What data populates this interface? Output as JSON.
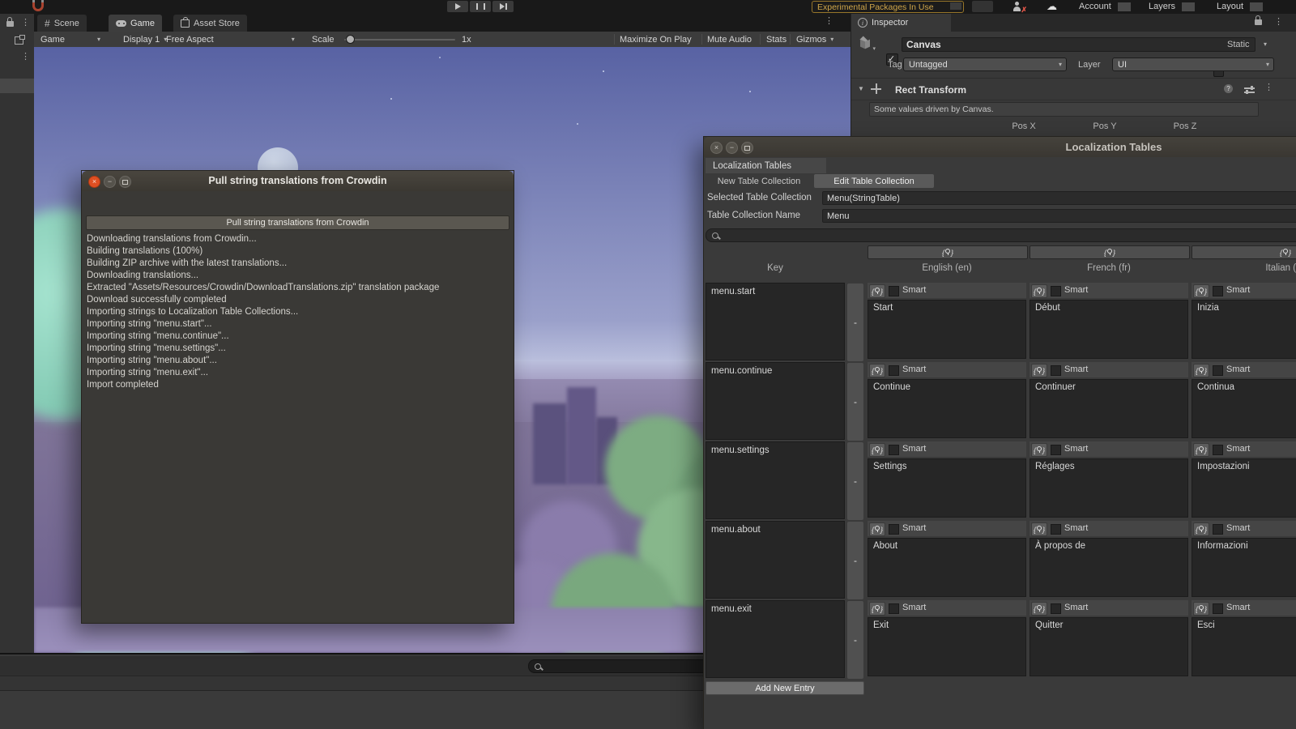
{
  "colors": {
    "warning_accent": "#cfa64a",
    "close_button": "#df4f22",
    "panel_bg": "#383838"
  },
  "top_toolbar": {
    "experimental_badge": "Experimental Packages In Use",
    "account": "Account",
    "layers": "Layers",
    "layout": "Layout"
  },
  "view_tabs": {
    "scene": "Scene",
    "game": "Game",
    "asset_store": "Asset Store"
  },
  "game_toolbar": {
    "target": "Game",
    "display": "Display 1",
    "aspect": "Free Aspect",
    "scale_label": "Scale",
    "scale_value": "1x",
    "maximize": "Maximize On Play",
    "mute": "Mute Audio",
    "stats": "Stats",
    "gizmos": "Gizmos"
  },
  "inspector": {
    "tab": "Inspector",
    "object_name": "Canvas",
    "static_label": "Static",
    "tag_label": "Tag",
    "tag_value": "Untagged",
    "layer_label": "Layer",
    "layer_value": "UI",
    "component": "Rect Transform",
    "helpbox": "Some values driven by Canvas.",
    "pos_x": "Pos X",
    "pos_y": "Pos Y",
    "pos_z": "Pos Z"
  },
  "dialog": {
    "title": "Pull string translations from Crowdin",
    "button": "Pull string translations from Crowdin",
    "log": [
      "Downloading translations from Crowdin...",
      "Building translations (100%)",
      "Building ZIP archive with the latest translations...",
      "Downloading translations...",
      "Extracted \"Assets/Resources/Crowdin/DownloadTranslations.zip\" translation package",
      "Download successfully completed",
      "Importing strings to Localization Table Collections...",
      "Importing string \"menu.start\"...",
      "Importing string \"menu.continue\"...",
      "Importing string \"menu.settings\"...",
      "Importing string \"menu.about\"...",
      "Importing string \"menu.exit\"...",
      "Import completed"
    ]
  },
  "loc": {
    "title": "Localization Tables",
    "tab": "Localization Tables",
    "tab_new": "New Table Collection",
    "tab_edit": "Edit Table Collection",
    "selected_label": "Selected Table Collection",
    "selected_value": "Menu(StringTable)",
    "name_label": "Table Collection Name",
    "name_value": "Menu",
    "table": {
      "key_header": "Key",
      "columns": [
        "English (en)",
        "French (fr)",
        "Italian (it)"
      ],
      "smart_label": "Smart",
      "remove_label": "-",
      "add_button": "Add New Entry",
      "rows": [
        {
          "key": "menu.start",
          "values": [
            "Start",
            "Début",
            "Inizia"
          ]
        },
        {
          "key": "menu.continue",
          "values": [
            "Continue",
            "Continuer",
            "Continua"
          ]
        },
        {
          "key": "menu.settings",
          "values": [
            "Settings",
            "Réglages",
            "Impostazioni"
          ]
        },
        {
          "key": "menu.about",
          "values": [
            "About",
            "À propos de",
            "Informazioni"
          ]
        },
        {
          "key": "menu.exit",
          "values": [
            "Exit",
            "Quitter",
            "Esci"
          ]
        }
      ]
    }
  }
}
